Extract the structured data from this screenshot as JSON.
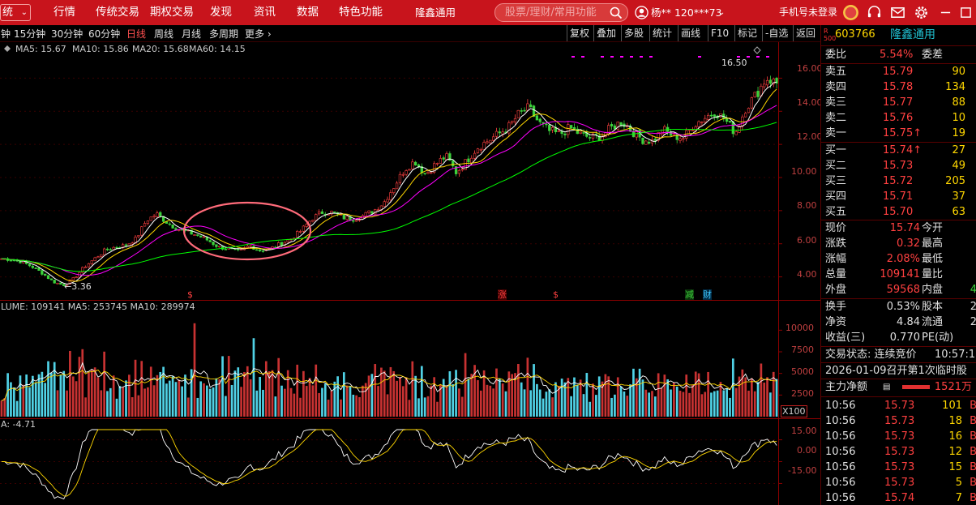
{
  "topbar": {
    "system_menu": "统",
    "nav": [
      "行情",
      "传统交易",
      "期权交易",
      "发现",
      "资讯",
      "数据",
      "特色功能",
      "隆鑫通用"
    ],
    "search_placeholder": "股票/理财/常用功能",
    "user": "杨** 120***73",
    "login_text": "手机号未登录"
  },
  "toolbar": {
    "periods": [
      "钟",
      "15分钟",
      "30分钟",
      "60分钟",
      "日线",
      "周线",
      "月线",
      "多周期",
      "更多"
    ],
    "active_period": "日线",
    "right_buttons": [
      "复权",
      "叠加",
      "多股",
      "统计",
      "画线",
      "F10",
      "标记",
      "-自选",
      "返回"
    ]
  },
  "colors": {
    "accent": "#c8141c",
    "up": "#ff4040",
    "down": "#3cd23c",
    "ma5": "#ffffff",
    "ma10": "#ffd700",
    "ma20": "#ff00ff",
    "ma60": "#00ff00",
    "vol_up": "#c83232",
    "vol_down": "#50d2e6",
    "circle": "#ff6b7a"
  },
  "ma_legend": [
    {
      "label": "MA5: 15.67",
      "color": "#ffffff"
    },
    {
      "label": "MA10: 15.86",
      "color": "#ffd700"
    },
    {
      "label": "MA20: 15.68",
      "color": "#ff40ff"
    },
    {
      "label": "MA60: 14.15",
      "color": "#40ff40"
    }
  ],
  "price_axis": [
    "16.00",
    "14.00",
    "12.00",
    "10.00",
    "8.00",
    "6.00",
    "4.00"
  ],
  "price_high": "16.50",
  "price_low": "3.36",
  "markers": [
    {
      "text": "$",
      "color": "#ff4040"
    },
    {
      "text": "涨",
      "color": "#ff4040"
    },
    {
      "text": "$",
      "color": "#ff4040"
    },
    {
      "text": "减",
      "color": "#3cd23c"
    },
    {
      "text": "财",
      "color": "#40c8ff"
    }
  ],
  "volume_legend": "LUME: 109141 MA5: 253745 MA10: 289974",
  "volume_axis": [
    "10000",
    "7500",
    "5000",
    "2500"
  ],
  "volume_unit": "X100",
  "indicator_legend": "A: -4.71",
  "indicator_axis": [
    "15.00",
    "0.00",
    "-15.00"
  ],
  "chart_data": {
    "type": "candlestick",
    "y_range": [
      3.0,
      17.0
    ],
    "y_ticks": [
      4,
      6,
      8,
      10,
      12,
      14,
      16
    ],
    "price_series": [
      5.1,
      5.05,
      4.9,
      4.6,
      4.2,
      3.7,
      3.5,
      3.9,
      4.6,
      5.1,
      5.6,
      5.8,
      5.9,
      6.3,
      7.4,
      7.8,
      7.3,
      6.9,
      6.7,
      6.5,
      6.2,
      5.8,
      5.7,
      5.5,
      5.9,
      5.6,
      5.7,
      6.0,
      6.3,
      6.8,
      7.5,
      7.9,
      7.9,
      7.6,
      7.5,
      7.7,
      8.0,
      8.5,
      9.5,
      10.5,
      11.0,
      10.2,
      10.8,
      11.3,
      10.3,
      11.0,
      11.8,
      12.2,
      12.6,
      13.0,
      13.8,
      14.2,
      13.3,
      12.8,
      12.6,
      13.0,
      12.6,
      12.4,
      12.5,
      13.0,
      13.4,
      12.8,
      12.3,
      12.2,
      12.9,
      12.5,
      12.4,
      13.2,
      13.6,
      14.0,
      13.5,
      12.7,
      14.2,
      15.0,
      16.0,
      15.7
    ],
    "volume_range": [
      0,
      12000
    ],
    "volume_ticks": [
      2500,
      5000,
      7500,
      10000
    ],
    "indicator_range": [
      -27,
      22
    ],
    "indicator_ticks": [
      -15,
      0,
      15
    ]
  },
  "stock": {
    "code": "603766",
    "name": "隆鑫通用",
    "badge_top": "R",
    "badge_bottom": "500"
  },
  "order_book": {
    "header": {
      "label": "委比",
      "value": "5.54%",
      "label2": "委差"
    },
    "asks": [
      {
        "label": "卖五",
        "price": "15.79",
        "vol": "90"
      },
      {
        "label": "卖四",
        "price": "15.78",
        "vol": "134"
      },
      {
        "label": "卖三",
        "price": "15.77",
        "vol": "88"
      },
      {
        "label": "卖二",
        "price": "15.76",
        "vol": "10"
      },
      {
        "label": "卖一",
        "price": "15.75",
        "arrow": "↑",
        "vol": "19"
      }
    ],
    "bids": [
      {
        "label": "买一",
        "price": "15.74",
        "arrow": "↑",
        "vol": "27"
      },
      {
        "label": "买二",
        "price": "15.73",
        "vol": "49"
      },
      {
        "label": "买三",
        "price": "15.72",
        "vol": "205"
      },
      {
        "label": "买四",
        "price": "15.71",
        "vol": "37"
      },
      {
        "label": "买五",
        "price": "15.70",
        "vol": "63"
      }
    ]
  },
  "quote": [
    {
      "l": "现价",
      "v": "15.74",
      "l2": "今开"
    },
    {
      "l": "涨跌",
      "v": "0.32",
      "l2": "最高"
    },
    {
      "l": "涨幅",
      "v": "2.08%",
      "l2": "最低"
    },
    {
      "l": "总量",
      "v": "109141",
      "l2": "量比"
    },
    {
      "l": "外盘",
      "v": "59568",
      "l2": "内盘",
      "tail": "4"
    }
  ],
  "stats": [
    {
      "l": "换手",
      "v": "0.53%",
      "l2": "股本",
      "tail": "2"
    },
    {
      "l": "净资",
      "v": "4.84",
      "l2": "流通",
      "tail": "2"
    },
    {
      "l": "收益(三)",
      "v": "0.770",
      "l2": "PE(动)"
    }
  ],
  "trade_status": {
    "text": "交易状态: 连续竞价",
    "time": "10:57:1"
  },
  "news": "2026-01-09召开第1次临时股",
  "main_flow": {
    "label": "主力净额",
    "value": "1521万"
  },
  "ticks": [
    {
      "t": "10:56",
      "p": "15.73",
      "v": "101",
      "f": "B"
    },
    {
      "t": "10:56",
      "p": "15.73",
      "v": "18",
      "f": "B"
    },
    {
      "t": "10:56",
      "p": "15.73",
      "v": "16",
      "f": "B"
    },
    {
      "t": "10:56",
      "p": "15.73",
      "v": "12",
      "f": "B"
    },
    {
      "t": "10:56",
      "p": "15.73",
      "v": "15",
      "f": "B"
    },
    {
      "t": "10:56",
      "p": "15.73",
      "v": "5",
      "f": "B"
    },
    {
      "t": "10:56",
      "p": "15.74",
      "v": "7",
      "f": "B"
    }
  ]
}
